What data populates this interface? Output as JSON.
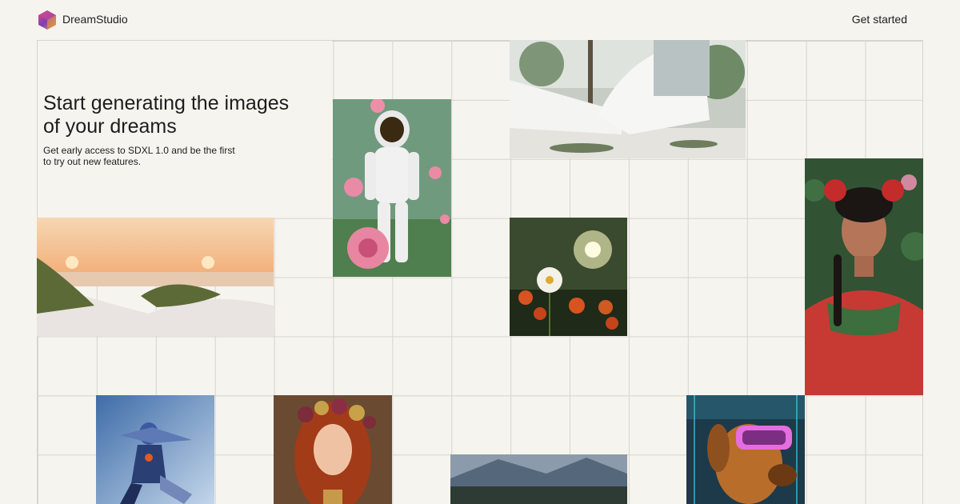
{
  "header": {
    "brand": "DreamStudio",
    "cta_label": "Get started"
  },
  "hero": {
    "title": "Start generating the images of your dreams",
    "subtitle": "Get early access to SDXL 1.0 and be the first to try out new features."
  },
  "gallery": {
    "images": [
      {
        "name": "astronaut-roses-image",
        "subject": "astronaut"
      },
      {
        "name": "modern-house-image",
        "subject": "house"
      },
      {
        "name": "frida-portrait-image",
        "subject": "portrait"
      },
      {
        "name": "sunset-dunes-image",
        "subject": "dunes"
      },
      {
        "name": "daisy-field-image",
        "subject": "daisy"
      },
      {
        "name": "cyber-knight-image",
        "subject": "robot"
      },
      {
        "name": "redhead-flower-crown-image",
        "subject": "portrait"
      },
      {
        "name": "mountain-lake-image",
        "subject": "landscape"
      },
      {
        "name": "vr-dog-image",
        "subject": "dog"
      }
    ]
  },
  "colors": {
    "background": "#f6f4ef",
    "grid_line": "#d7d4cd",
    "text": "#1d1d1d"
  }
}
